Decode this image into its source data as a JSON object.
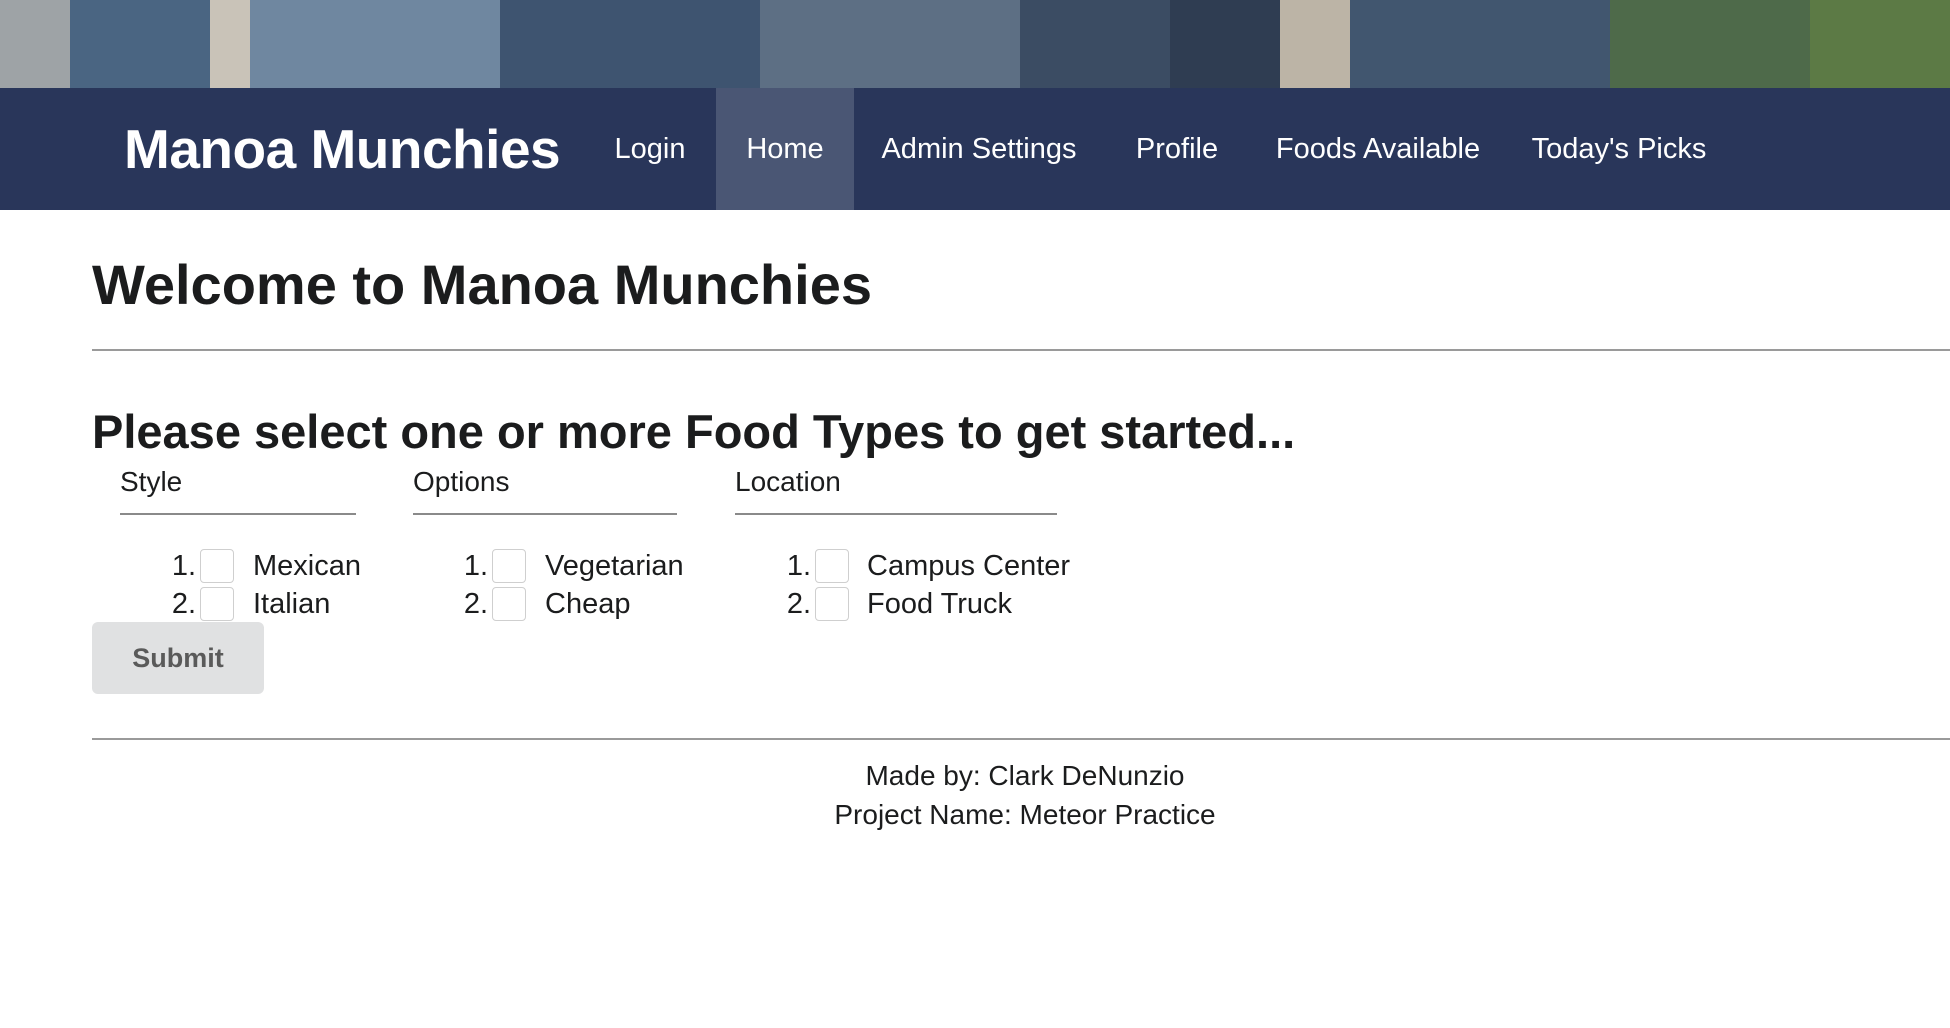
{
  "navbar": {
    "brand": "Manoa Munchies",
    "items": [
      {
        "label": "Login",
        "active": false
      },
      {
        "label": "Home",
        "active": true
      },
      {
        "label": "Admin Settings",
        "active": false
      },
      {
        "label": "Profile",
        "active": false
      },
      {
        "label": "Foods Available",
        "active": false
      },
      {
        "label": "Today's Picks",
        "active": false
      }
    ]
  },
  "main": {
    "title": "Welcome to Manoa Munchies",
    "prompt": "Please select one or more Food Types to get started...",
    "groups": [
      {
        "header": "Style",
        "options": [
          {
            "num": "1.",
            "label": "Mexican",
            "checked": false
          },
          {
            "num": "2.",
            "label": "Italian",
            "checked": false
          }
        ]
      },
      {
        "header": "Options",
        "options": [
          {
            "num": "1.",
            "label": "Vegetarian",
            "checked": false
          },
          {
            "num": "2.",
            "label": "Cheap",
            "checked": false
          }
        ]
      },
      {
        "header": "Location",
        "options": [
          {
            "num": "1.",
            "label": "Campus Center",
            "checked": false
          },
          {
            "num": "2.",
            "label": "Food Truck",
            "checked": false
          }
        ]
      }
    ],
    "submit_label": "Submit"
  },
  "footer": {
    "made_by": "Made by: Clark DeNunzio",
    "project": "Project Name: Meteor Practice"
  },
  "colors": {
    "navbar_bg": "#29365a",
    "nav_active_bg": "#4a5674",
    "button_bg": "#e0e1e2"
  }
}
